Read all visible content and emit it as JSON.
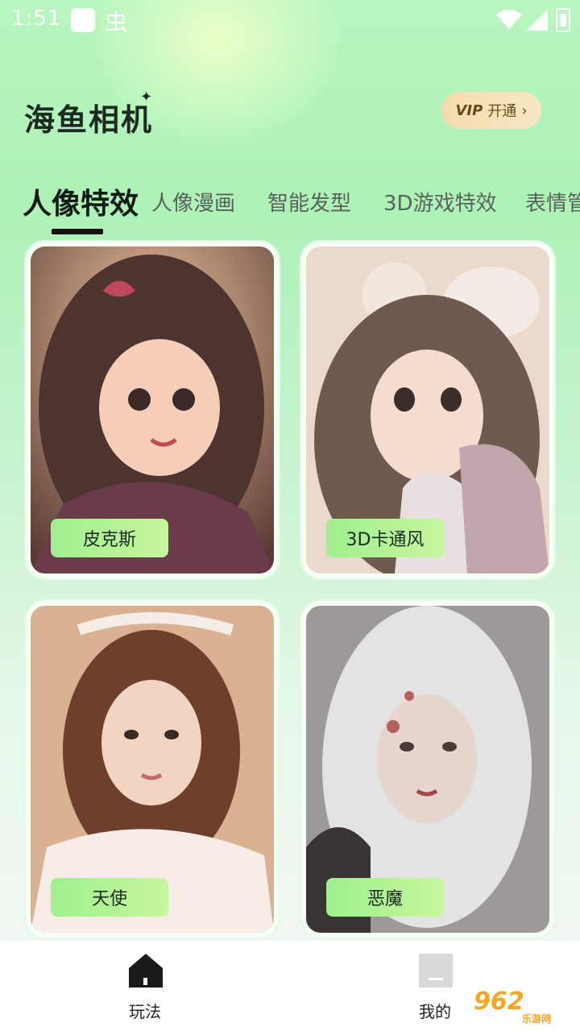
{
  "status_bar": {
    "time": "1:51"
  },
  "header": {
    "app_title": "海鱼相机",
    "vip_badge": "VIP",
    "vip_action": "开通",
    "vip_chevron": "›"
  },
  "tabs": [
    {
      "label": "人像特效",
      "active": true
    },
    {
      "label": "人像漫画",
      "active": false
    },
    {
      "label": "智能发型",
      "active": false
    },
    {
      "label": "3D游戏特效",
      "active": false
    },
    {
      "label": "表情管",
      "active": false
    }
  ],
  "cards": [
    {
      "label": "皮克斯",
      "image": "pixar-style-girl-portrait"
    },
    {
      "label": "3D卡通风",
      "image": "3d-cartoon-girl-portrait"
    },
    {
      "label": "天使",
      "image": "angel-style-girl-photo"
    },
    {
      "label": "恶魔",
      "image": "demon-style-girl-photo"
    }
  ],
  "bottom_nav": [
    {
      "label": "玩法",
      "icon": "home-icon",
      "active": true
    },
    {
      "label": "我的",
      "icon": "profile-icon",
      "active": false
    }
  ],
  "watermark": {
    "text": "962",
    "sub": "乐游网"
  }
}
